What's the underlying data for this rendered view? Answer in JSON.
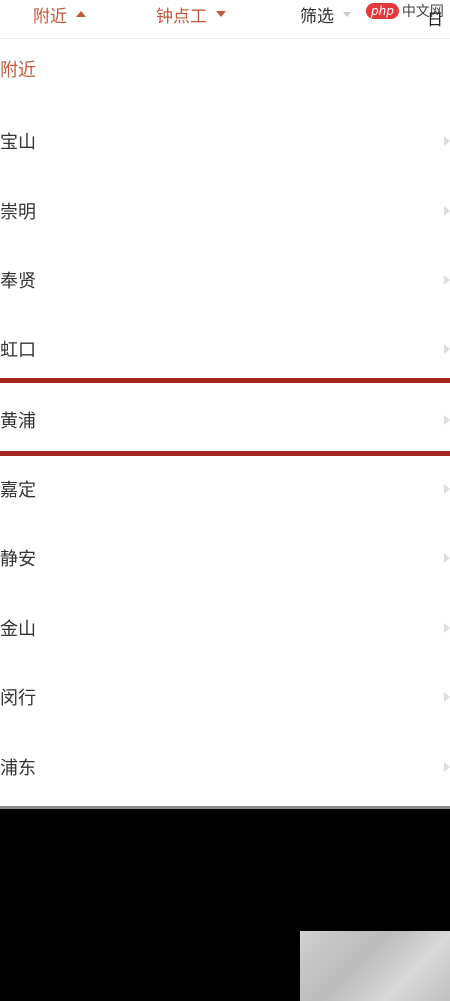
{
  "filter_bar": {
    "nearby_label": "附近",
    "job_type_label": "钟点工",
    "filter_label": "筛选"
  },
  "watermark": {
    "logo": "php",
    "text": "中文网"
  },
  "corner_glyph": "日",
  "district_list": {
    "header": "附近",
    "items": [
      {
        "label": "宝山"
      },
      {
        "label": "崇明"
      },
      {
        "label": "奉贤"
      },
      {
        "label": "虹口"
      },
      {
        "label": "黄浦"
      },
      {
        "label": "嘉定"
      },
      {
        "label": "静安"
      },
      {
        "label": "金山"
      },
      {
        "label": "闵行"
      },
      {
        "label": "浦东"
      }
    ]
  },
  "colors": {
    "accent": "#c15a3a",
    "highlight": "#a52620"
  }
}
